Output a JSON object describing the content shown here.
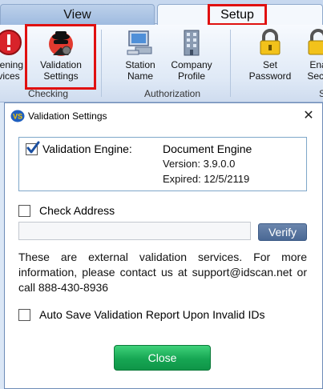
{
  "ribbon": {
    "tabs": [
      {
        "label": "View",
        "selected": false
      },
      {
        "label": "Setup",
        "selected": true
      }
    ],
    "buttons": {
      "screening": {
        "line1": "eening",
        "line2": "vices",
        "icon": "stop-icon"
      },
      "validation": {
        "line1": "Validation",
        "line2": "Settings",
        "icon": "spy-agent-icon"
      },
      "station": {
        "line1": "Station",
        "line2": "Name",
        "icon": "computer-icon"
      },
      "company": {
        "line1": "Company",
        "line2": "Profile",
        "icon": "building-icon"
      },
      "password": {
        "line1": "Set",
        "line2": "Password",
        "icon": "padlock-icon"
      },
      "enable": {
        "line1": "Ena",
        "line2": "Secu",
        "icon": "padlock-icon"
      }
    },
    "groups": {
      "checking": "Checking",
      "authorization": "Authorization",
      "s": "S"
    },
    "highlight_color": "#e01010"
  },
  "dialog": {
    "title": "Validation Settings",
    "app_icon_text": "VS",
    "close_glyph": "✕",
    "engine": {
      "checked": true,
      "label": "Validation Engine:",
      "name": "Document Engine",
      "version": "Version: 3.9.0.0",
      "expired": "Expired: 12/5/2119"
    },
    "check_address": {
      "checked": false,
      "label": "Check Address",
      "value": "",
      "verify_label": "Verify"
    },
    "info": "These are external validation services. For more information, please contact us at support@idscan.net or call 888-430-8936",
    "auto_save": {
      "checked": false,
      "label": "Auto Save Validation Report Upon Invalid IDs"
    },
    "close_label": "Close"
  }
}
